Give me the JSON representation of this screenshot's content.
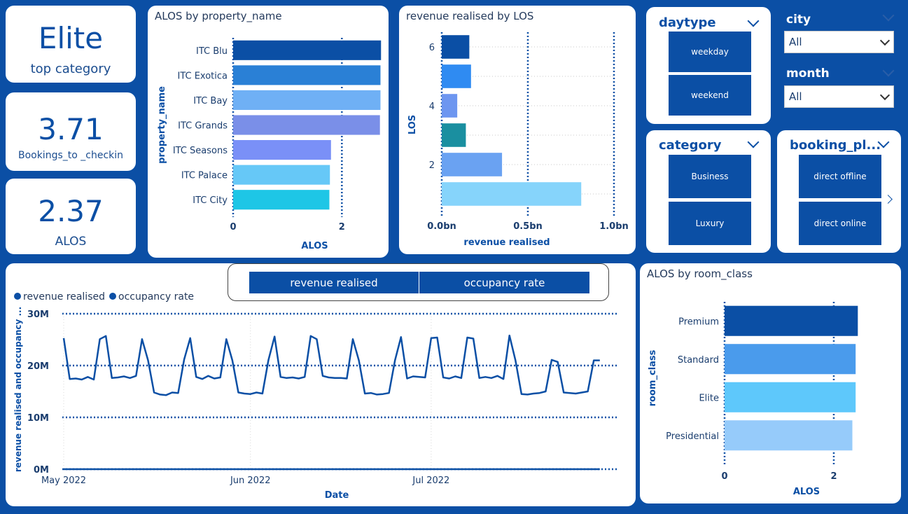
{
  "kpis": {
    "top_category": {
      "value": "Elite",
      "label": "top category"
    },
    "bookings": {
      "value": "3.71",
      "label": "Bookings_to _checkin"
    },
    "alos": {
      "value": "2.37",
      "label": "ALOS"
    }
  },
  "slicers": {
    "daytype": {
      "title": "daytype",
      "options": [
        "weekday",
        "weekend"
      ]
    },
    "category": {
      "title": "category",
      "options": [
        "Business",
        "Luxury"
      ]
    },
    "booking_platform": {
      "title": "booking_pl...",
      "options": [
        "direct offline",
        "direct online"
      ]
    },
    "city": {
      "title": "city",
      "value": "All"
    },
    "month": {
      "title": "month",
      "value": "All"
    }
  },
  "toggle": {
    "revenue": "revenue realised",
    "occupancy": "occupancy rate"
  },
  "colors": {
    "background": "#0b4fa5",
    "accent": "#0b4fa5",
    "line": "#0b4fa5"
  },
  "chart_data": [
    {
      "id": "alos_property",
      "type": "bar",
      "orientation": "horizontal",
      "title": "ALOS by property_name",
      "xlabel": "ALOS",
      "ylabel": "property_name",
      "categories": [
        "ITC Blu",
        "ITC Exotica",
        "ITC Bay",
        "ITC Grands",
        "ITC Seasons",
        "ITC Palace",
        "ITC City"
      ],
      "values": [
        2.72,
        2.71,
        2.71,
        2.7,
        1.8,
        1.78,
        1.77
      ],
      "colors": [
        "#0b4fa5",
        "#2a80d6",
        "#6fb0f5",
        "#7a8fe8",
        "#7a90f7",
        "#66c8f7",
        "#1ec6e6"
      ],
      "xlim": [
        0,
        3.0
      ],
      "xticks": [
        "0",
        "2"
      ],
      "xtick_values": [
        0,
        2
      ]
    },
    {
      "id": "revenue_los",
      "type": "bar",
      "orientation": "horizontal",
      "title": "revenue realised by LOS",
      "xlabel": "revenue realised",
      "ylabel": "LOS",
      "categories": [
        "6",
        "5",
        "4",
        "3",
        "2",
        "1"
      ],
      "values": [
        0.16,
        0.17,
        0.09,
        0.14,
        0.35,
        0.81
      ],
      "colors": [
        "#0b4fa5",
        "#2f8bf2",
        "#6d96f0",
        "#1a8fa0",
        "#6aa2f2",
        "#86d4fb"
      ],
      "xlim": [
        0,
        1.0
      ],
      "xticks": [
        "0.0bn",
        "0.5bn",
        "1.0bn"
      ],
      "xtick_values": [
        0,
        0.5,
        1.0
      ],
      "yticks": [
        "6",
        "4",
        "2"
      ],
      "ytick_values": [
        6,
        4,
        2
      ]
    },
    {
      "id": "revenue_occupancy",
      "type": "line",
      "title": "",
      "xlabel": "Date",
      "ylabel": "revenue realised and occupancy ...",
      "legend": [
        "revenue realised",
        "occupancy rate"
      ],
      "yticks": [
        "0M",
        "10M",
        "20M",
        "30M"
      ],
      "ytick_values": [
        0,
        10,
        20,
        30
      ],
      "ylim": [
        0,
        30
      ],
      "xticks": [
        "May 2022",
        "Jun 2022",
        "Jul 2022"
      ],
      "x": [
        "2022-05-01",
        "2022-05-02",
        "2022-05-03",
        "2022-05-04",
        "2022-05-05",
        "2022-05-06",
        "2022-05-07",
        "2022-05-08",
        "2022-05-09",
        "2022-05-10",
        "2022-05-11",
        "2022-05-12",
        "2022-05-13",
        "2022-05-14",
        "2022-05-15",
        "2022-05-16",
        "2022-05-17",
        "2022-05-18",
        "2022-05-19",
        "2022-05-20",
        "2022-05-21",
        "2022-05-22",
        "2022-05-23",
        "2022-05-24",
        "2022-05-25",
        "2022-05-26",
        "2022-05-27",
        "2022-05-28",
        "2022-05-29",
        "2022-05-30",
        "2022-05-31",
        "2022-06-01",
        "2022-06-02",
        "2022-06-03",
        "2022-06-04",
        "2022-06-05",
        "2022-06-06",
        "2022-06-07",
        "2022-06-08",
        "2022-06-09",
        "2022-06-10",
        "2022-06-11",
        "2022-06-12",
        "2022-06-13",
        "2022-06-14",
        "2022-06-15",
        "2022-06-16",
        "2022-06-17",
        "2022-06-18",
        "2022-06-19",
        "2022-06-20",
        "2022-06-21",
        "2022-06-22",
        "2022-06-23",
        "2022-06-24",
        "2022-06-25",
        "2022-06-26",
        "2022-06-27",
        "2022-06-28",
        "2022-06-29",
        "2022-06-30",
        "2022-07-01",
        "2022-07-02",
        "2022-07-03",
        "2022-07-04",
        "2022-07-05",
        "2022-07-06",
        "2022-07-07",
        "2022-07-08",
        "2022-07-09",
        "2022-07-10",
        "2022-07-11",
        "2022-07-12",
        "2022-07-13",
        "2022-07-14",
        "2022-07-15",
        "2022-07-16",
        "2022-07-17",
        "2022-07-18",
        "2022-07-19",
        "2022-07-20",
        "2022-07-21",
        "2022-07-22",
        "2022-07-23",
        "2022-07-24",
        "2022-07-25",
        "2022-07-26",
        "2022-07-27",
        "2022-07-28",
        "2022-07-29",
        "2022-07-30",
        "2022-07-31"
      ],
      "series": [
        {
          "name": "revenue realised",
          "values": [
            25.3,
            17.4,
            17.5,
            17.3,
            17.8,
            17.3,
            25.1,
            25.7,
            17.6,
            17.7,
            17.9,
            17.6,
            18.0,
            25.1,
            21.0,
            14.8,
            14.4,
            14.3,
            14.8,
            14.7,
            21.2,
            25.3,
            17.8,
            17.4,
            18.0,
            17.5,
            17.7,
            25.1,
            21.0,
            14.8,
            14.6,
            14.5,
            14.8,
            14.6,
            21.1,
            25.6,
            17.8,
            17.6,
            17.7,
            17.5,
            17.8,
            25.7,
            25.1,
            18.0,
            17.7,
            17.6,
            17.6,
            17.5,
            25.1,
            21.0,
            14.6,
            14.7,
            14.4,
            14.5,
            14.7,
            21.0,
            25.5,
            17.5,
            17.9,
            17.8,
            17.7,
            25.3,
            25.4,
            17.7,
            17.5,
            17.9,
            17.6,
            25.4,
            25.2,
            17.6,
            17.8,
            17.6,
            18.0,
            17.4,
            25.8,
            21.0,
            14.5,
            14.4,
            14.6,
            14.7,
            15.0,
            21.1,
            20.7,
            14.8,
            14.7,
            14.6,
            14.8,
            15.0,
            21.0,
            21.0
          ]
        },
        {
          "name": "occupancy rate",
          "values": [
            0.0006,
            0.0006,
            0.0006,
            0.0006,
            0.0006,
            0.0006,
            0.0006,
            0.0006,
            0.0006,
            0.0006,
            0.0006,
            0.0006,
            0.0006,
            0.0006,
            0.0006,
            0.0006,
            0.0006,
            0.0006,
            0.0006,
            0.0006,
            0.0006,
            0.0006,
            0.0006,
            0.0006,
            0.0006,
            0.0006,
            0.0006,
            0.0006,
            0.0006,
            0.0006,
            0.0006,
            0.0006,
            0.0006,
            0.0006,
            0.0006,
            0.0006,
            0.0006,
            0.0006,
            0.0006,
            0.0006,
            0.0006,
            0.0006,
            0.0006,
            0.0006,
            0.0006,
            0.0006,
            0.0006,
            0.0006,
            0.0006,
            0.0006,
            0.0006,
            0.0006,
            0.0006,
            0.0006,
            0.0006,
            0.0006,
            0.0006,
            0.0006,
            0.0006,
            0.0006,
            0.0006,
            0.0006,
            0.0006,
            0.0006,
            0.0006,
            0.0006,
            0.0006,
            0.0006,
            0.0006,
            0.0006,
            0.0006,
            0.0006,
            0.0006,
            0.0006,
            0.0006,
            0.0006,
            0.0006,
            0.0006,
            0.0006,
            0.0006,
            0.0006,
            0.0006,
            0.0006,
            0.0006,
            0.0006,
            0.0006,
            0.0006,
            0.0006,
            0.0006,
            0.0006
          ]
        }
      ]
    },
    {
      "id": "alos_room_class",
      "type": "bar",
      "orientation": "horizontal",
      "title": "ALOS by room_class",
      "xlabel": "ALOS",
      "ylabel": "room_class",
      "categories": [
        "Premium",
        "Standard",
        "Elite",
        "Presidential"
      ],
      "values": [
        2.44,
        2.4,
        2.4,
        2.34
      ],
      "colors": [
        "#0b4fa5",
        "#4a9bec",
        "#5ec8fb",
        "#96cbfa"
      ],
      "xlim": [
        0,
        3.0
      ],
      "xticks": [
        "0",
        "2"
      ],
      "xtick_values": [
        0,
        2
      ]
    }
  ]
}
